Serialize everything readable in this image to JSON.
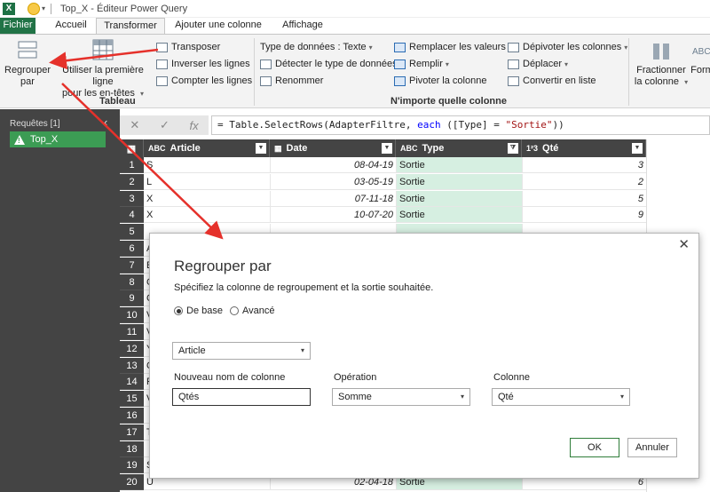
{
  "titlebar": {
    "app_logo": "X",
    "title": "Top_X - Éditeur Power Query"
  },
  "tabs": [
    "Fichier",
    "Accueil",
    "Transformer",
    "Ajouter une colonne",
    "Affichage"
  ],
  "ribbon": {
    "regrouper": "Regrouper\npar",
    "utiliser": "Utiliser la première ligne\npour les en-têtes",
    "group_tableau_items": [
      "Transposer",
      "Inverser les lignes",
      "Compter les lignes"
    ],
    "group_tableau_label": "Tableau",
    "col2_items": [
      "Type de données : Texte",
      "Détecter le type de données",
      "Renommer"
    ],
    "col3_items": [
      "Remplacer les valeurs",
      "Remplir",
      "Pivoter la colonne"
    ],
    "col4_items": [
      "Dépivoter les colonnes",
      "Déplacer",
      "Convertir en liste"
    ],
    "group_any_label": "N'importe quelle colonne",
    "fractionner": "Fractionner\nla colonne",
    "forme": "Form"
  },
  "leftpane": {
    "header": "Requêtes [1]",
    "query": "Top_X"
  },
  "formula": {
    "prefix": "= Table.SelectRows(AdapterFiltre, ",
    "kw": "each",
    "mid": " ([Type] = ",
    "str": "\"Sortie\"",
    "end": "))"
  },
  "grid": {
    "headers": [
      {
        "type": "ABC",
        "name": "Article"
      },
      {
        "type": "▦",
        "name": "Date"
      },
      {
        "type": "ABC",
        "name": "Type"
      },
      {
        "type": "1²3",
        "name": "Qté"
      }
    ],
    "rows": [
      {
        "n": "1",
        "article": "S",
        "date": "08-04-19",
        "type": "Sortie",
        "qte": "3"
      },
      {
        "n": "2",
        "article": "L",
        "date": "03-05-19",
        "type": "Sortie",
        "qte": "2"
      },
      {
        "n": "3",
        "article": "X",
        "date": "07-11-18",
        "type": "Sortie",
        "qte": "5"
      },
      {
        "n": "4",
        "article": "X",
        "date": "10-07-20",
        "type": "Sortie",
        "qte": "9"
      },
      {
        "n": "5",
        "article": "",
        "date": "",
        "type": "",
        "qte": ""
      },
      {
        "n": "6",
        "article": "A",
        "date": "",
        "type": "",
        "qte": ""
      },
      {
        "n": "7",
        "article": "E",
        "date": "",
        "type": "",
        "qte": ""
      },
      {
        "n": "8",
        "article": "G",
        "date": "",
        "type": "",
        "qte": ""
      },
      {
        "n": "9",
        "article": "C",
        "date": "",
        "type": "",
        "qte": ""
      },
      {
        "n": "10",
        "article": "V",
        "date": "",
        "type": "",
        "qte": ""
      },
      {
        "n": "11",
        "article": "V",
        "date": "",
        "type": "",
        "qte": ""
      },
      {
        "n": "12",
        "article": "Y",
        "date": "",
        "type": "",
        "qte": ""
      },
      {
        "n": "13",
        "article": "O",
        "date": "",
        "type": "",
        "qte": ""
      },
      {
        "n": "14",
        "article": "F",
        "date": "",
        "type": "",
        "qte": ""
      },
      {
        "n": "15",
        "article": "V",
        "date": "",
        "type": "",
        "qte": ""
      },
      {
        "n": "16",
        "article": "",
        "date": "",
        "type": "",
        "qte": ""
      },
      {
        "n": "17",
        "article": "T",
        "date": "",
        "type": "",
        "qte": ""
      },
      {
        "n": "18",
        "article": "",
        "date": "",
        "type": "",
        "qte": ""
      },
      {
        "n": "19",
        "article": "S",
        "date": "",
        "type": "",
        "qte": ""
      },
      {
        "n": "20",
        "article": "U",
        "date": "02-04-18",
        "type": "Sortie",
        "qte": "6"
      }
    ]
  },
  "dialog": {
    "title": "Regrouper par",
    "subtitle": "Spécifiez la colonne de regroupement et la sortie souhaitée.",
    "radio_basic": "De base",
    "radio_advanced": "Avancé",
    "group_by_value": "Article",
    "label_new_col": "Nouveau nom de colonne",
    "label_operation": "Opération",
    "label_column": "Colonne",
    "new_col_value": "Qtés",
    "operation_value": "Somme",
    "column_value": "Qté",
    "ok": "OK",
    "cancel": "Annuler"
  }
}
